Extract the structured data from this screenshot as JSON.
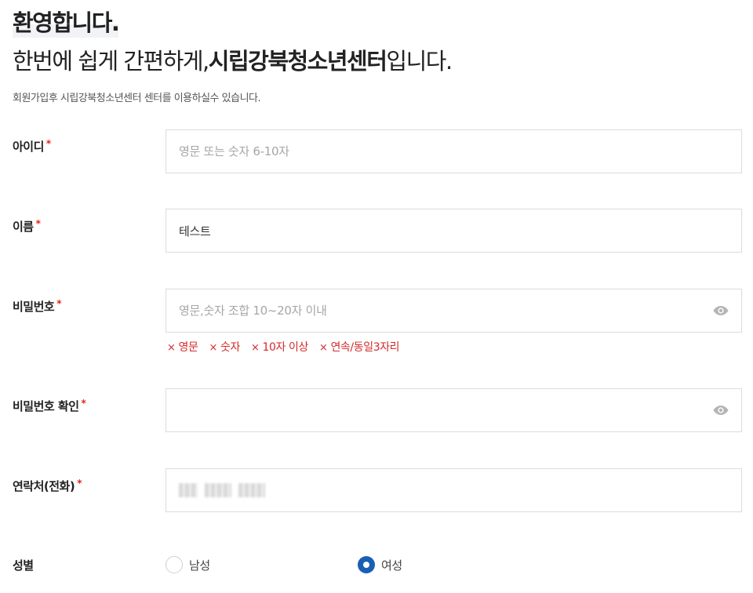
{
  "header": {
    "welcome": "환영합니다.",
    "subtitle_prefix": "한번에 쉽게 간편하게,",
    "subtitle_brand": "시립강북청소년센터",
    "subtitle_suffix": "입니다.",
    "description": "회원가입후 시립강북청소년센터 센터를 이용하실수 있습니다."
  },
  "form": {
    "required_mark": "*",
    "userid": {
      "label": "아이디",
      "value": "",
      "placeholder": "영문 또는 숫자 6-10자"
    },
    "name": {
      "label": "이름",
      "value": "테스트",
      "placeholder": ""
    },
    "password": {
      "label": "비밀번호",
      "value": "",
      "placeholder": "영문,숫자 조합 10~20자 이내",
      "icon": "eye-icon"
    },
    "password_rules": [
      "영문",
      "숫자",
      "10자 이상",
      "연속/동일3자리"
    ],
    "password_rule_mark": "×",
    "password_confirm": {
      "label": "비밀번호 확인",
      "value": "",
      "placeholder": "",
      "icon": "eye-icon"
    },
    "phone": {
      "label": "연락처(전화)",
      "value_note": "blurred"
    },
    "gender": {
      "label": "성별",
      "options": [
        {
          "label": "남성",
          "checked": false
        },
        {
          "label": "여성",
          "checked": true
        }
      ]
    }
  },
  "colors": {
    "required": "#e0241c",
    "error": "#d42a2a",
    "radio_checked": "#1a5fb4",
    "border": "#dcdcdc"
  }
}
